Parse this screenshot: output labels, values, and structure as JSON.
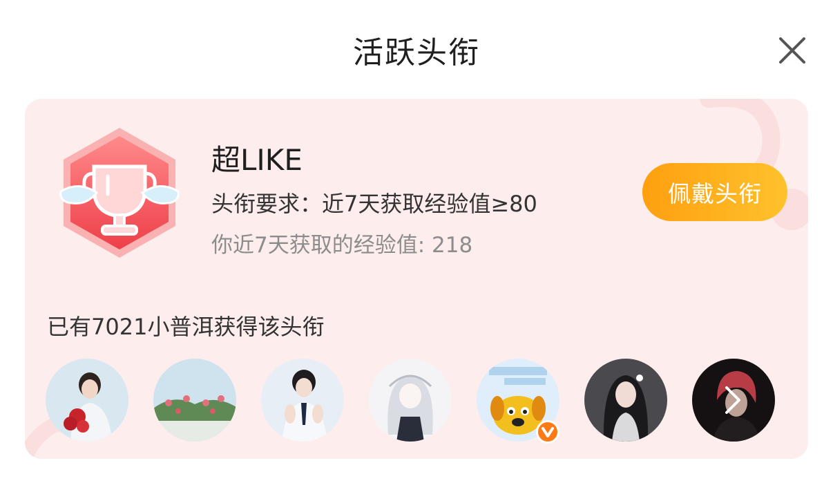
{
  "dialog": {
    "title": "活跃头衔",
    "close_icon": "close-icon"
  },
  "badge": {
    "icon": "trophy-wings-badge-icon",
    "name": "超LIKE",
    "requirement": "头衔要求：近7天获取经验值≥80",
    "my_exp": "你近7天获取的经验值: 218",
    "wear_label": "佩戴头衔"
  },
  "holders": {
    "summary": "已有7021小普洱获得该头衔",
    "avatars": [
      "avatar-boy-with-flowers",
      "avatar-flowers-wall",
      "avatar-boy-hands",
      "avatar-anime-girl",
      "avatar-yellow-dog-verified",
      "avatar-girl-dark",
      "avatar-red-hair"
    ],
    "more_icon": "chevron-right-icon"
  },
  "colors": {
    "card_bg": "#fdeded",
    "button_gradient_start": "#ff9f10",
    "button_gradient_end": "#ffc22c",
    "badge_red": "#f2545b",
    "verified_orange": "#ff7a14"
  }
}
